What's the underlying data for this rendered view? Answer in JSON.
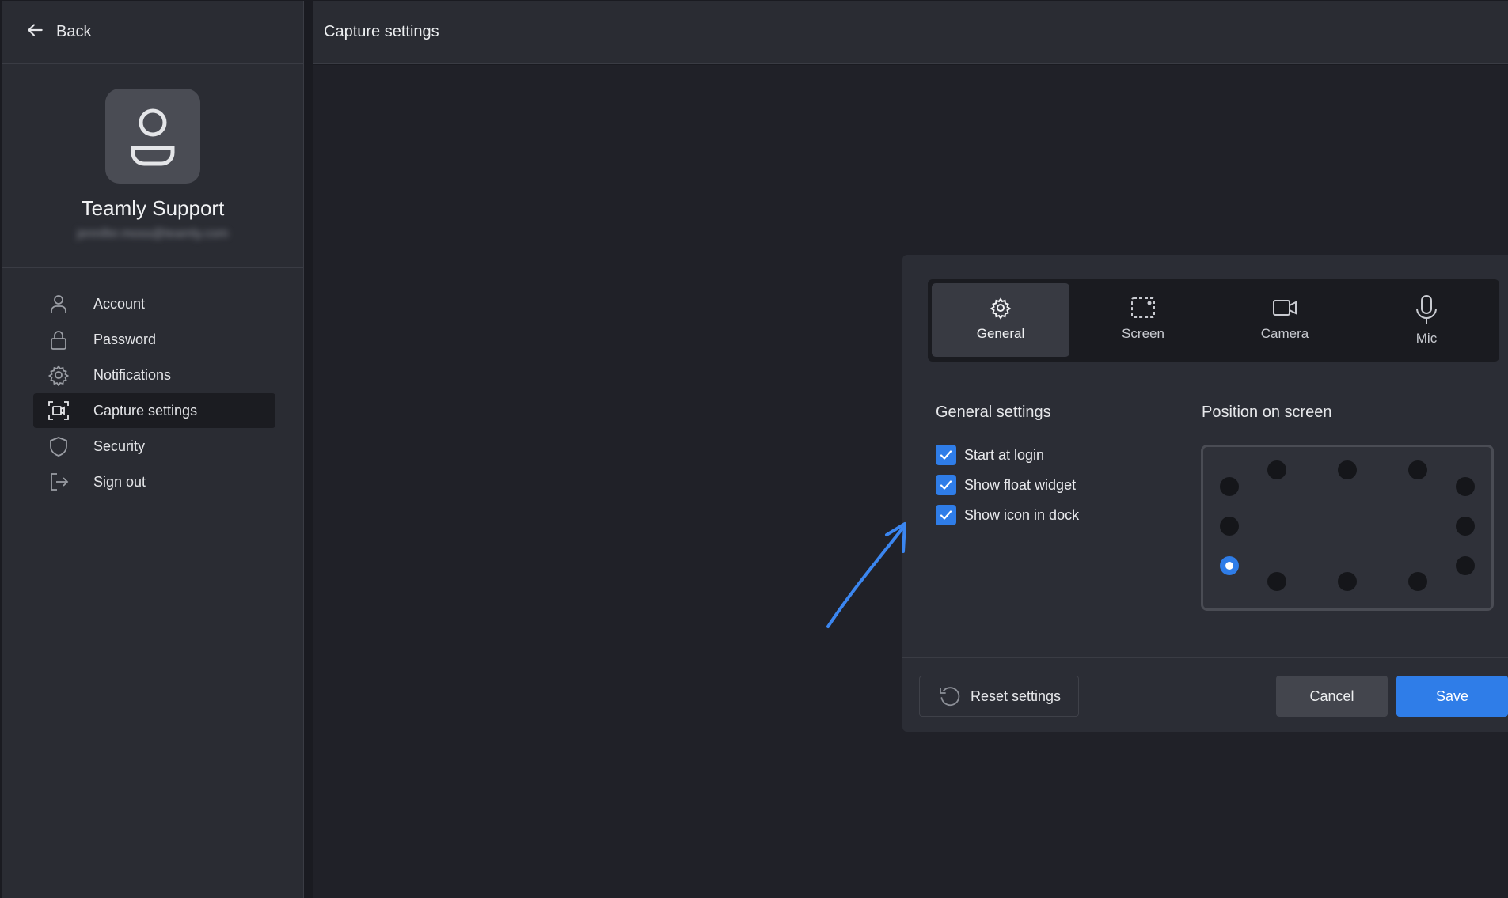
{
  "sidebar": {
    "back_label": "Back",
    "profile": {
      "name": "Teamly Support",
      "email": "jennifer.moss@teamly.com"
    },
    "items": [
      {
        "label": "Account",
        "icon": "user-icon",
        "active": false
      },
      {
        "label": "Password",
        "icon": "lock-icon",
        "active": false
      },
      {
        "label": "Notifications",
        "icon": "gear-icon",
        "active": false
      },
      {
        "label": "Capture settings",
        "icon": "capture-icon",
        "active": true
      },
      {
        "label": "Security",
        "icon": "shield-icon",
        "active": false
      },
      {
        "label": "Sign out",
        "icon": "sign-out-icon",
        "active": false
      }
    ]
  },
  "header": {
    "title": "Capture settings"
  },
  "dialog": {
    "tabs": [
      {
        "label": "General",
        "icon": "gear-icon",
        "active": true
      },
      {
        "label": "Screen",
        "icon": "screen-select-icon",
        "active": false
      },
      {
        "label": "Camera",
        "icon": "camera-icon",
        "active": false
      },
      {
        "label": "Mic",
        "icon": "microphone-icon",
        "active": false
      }
    ],
    "general_title": "General settings",
    "checkboxes": [
      {
        "label": "Start at login",
        "checked": true
      },
      {
        "label": "Show float widget",
        "checked": true
      },
      {
        "label": "Show icon in dock",
        "checked": true
      }
    ],
    "position_title": "Position on screen",
    "position_selected": "left-bottom",
    "buttons": {
      "reset": "Reset settings",
      "cancel": "Cancel",
      "save": "Save"
    }
  },
  "colors": {
    "accent": "#2f7de8",
    "background": "#202128",
    "panel": "#2a2c33",
    "annotation_arrow": "#3b86f0"
  }
}
